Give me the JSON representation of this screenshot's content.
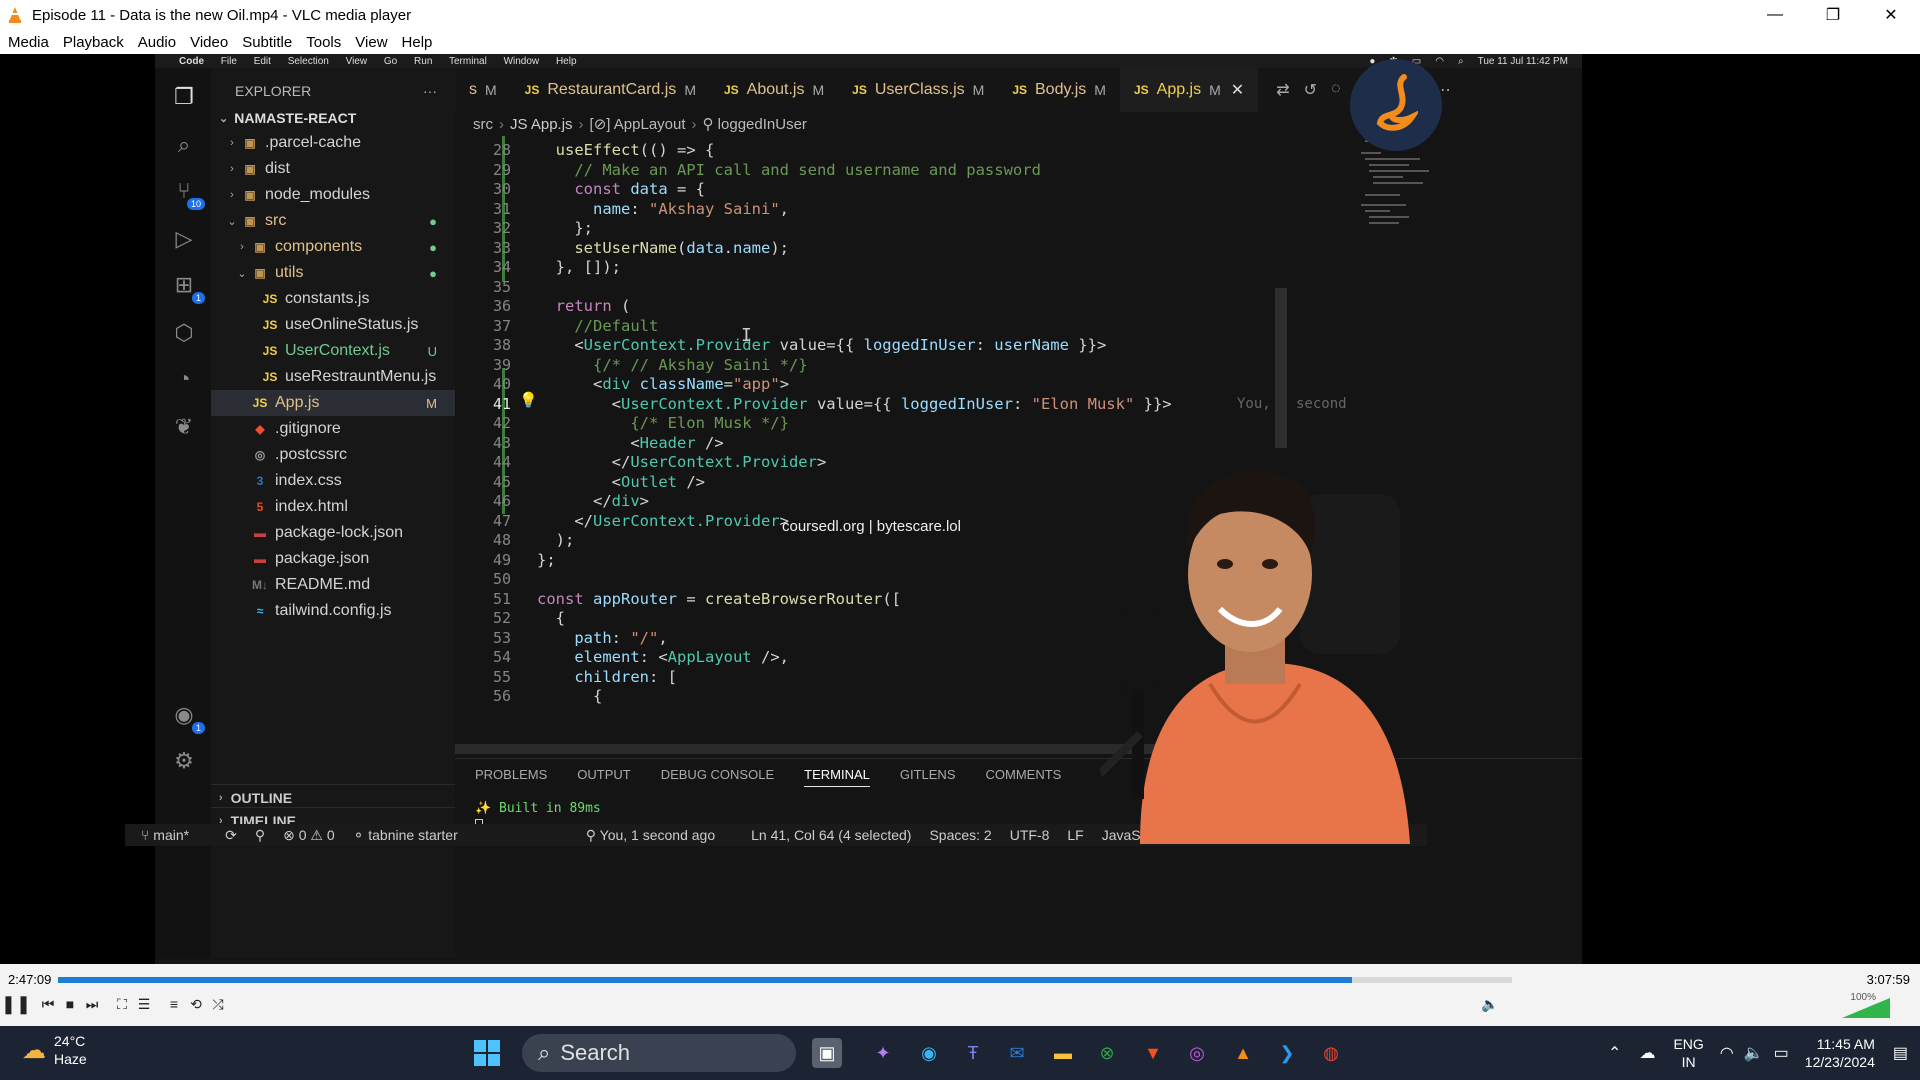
{
  "window": {
    "title": "Episode 11 - Data is the new Oil.mp4 - VLC media player",
    "controls": [
      "—",
      "❐",
      "✕"
    ]
  },
  "menu": [
    "Media",
    "Playback",
    "Audio",
    "Video",
    "Subtitle",
    "Tools",
    "View",
    "Help"
  ],
  "mac_menubar": {
    "items": [
      "Code",
      "File",
      "Edit",
      "Selection",
      "View",
      "Go",
      "Run",
      "Terminal",
      "Window",
      "Help"
    ],
    "clock": "Tue 11 Jul 11:42 PM"
  },
  "vscode": {
    "explorer_title": "EXPLORER",
    "explorer_more": "···",
    "project": "NAMASTE-REACT",
    "tree": [
      {
        "label": ".parcel-cache",
        "type": "folder",
        "indent": 1,
        "open": false,
        "mark": ""
      },
      {
        "label": "dist",
        "type": "folder",
        "indent": 1,
        "open": false,
        "mark": ""
      },
      {
        "label": "node_modules",
        "type": "folder",
        "indent": 1,
        "open": false,
        "mark": ""
      },
      {
        "label": "src",
        "type": "folder",
        "indent": 1,
        "open": true,
        "mark": "●"
      },
      {
        "label": "components",
        "type": "folder",
        "indent": 2,
        "open": false,
        "mark": "●"
      },
      {
        "label": "utils",
        "type": "folder",
        "indent": 2,
        "open": true,
        "mark": "●"
      },
      {
        "label": "constants.js",
        "type": "js",
        "indent": 3,
        "mark": ""
      },
      {
        "label": "useOnlineStatus.js",
        "type": "js",
        "indent": 3,
        "mark": ""
      },
      {
        "label": "UserContext.js",
        "type": "js",
        "indent": 3,
        "mark": "U"
      },
      {
        "label": "useRestrauntMenu.js",
        "type": "js",
        "indent": 3,
        "mark": ""
      },
      {
        "label": "App.js",
        "type": "js",
        "indent": 2,
        "mark": "M"
      },
      {
        "label": ".gitignore",
        "type": "git",
        "indent": 2,
        "mark": ""
      },
      {
        "label": ".postcssrc",
        "type": "cfg",
        "indent": 2,
        "mark": ""
      },
      {
        "label": "index.css",
        "type": "css",
        "indent": 2,
        "mark": ""
      },
      {
        "label": "index.html",
        "type": "html",
        "indent": 2,
        "mark": ""
      },
      {
        "label": "package-lock.json",
        "type": "json",
        "indent": 2,
        "mark": ""
      },
      {
        "label": "package.json",
        "type": "json",
        "indent": 2,
        "mark": ""
      },
      {
        "label": "README.md",
        "type": "md",
        "indent": 2,
        "mark": ""
      },
      {
        "label": "tailwind.config.js",
        "type": "tw",
        "indent": 2,
        "mark": ""
      }
    ],
    "outline": "OUTLINE",
    "timeline": "TIMELINE",
    "activity_badges": {
      "scm": "10",
      "extensions": "1",
      "accounts": "1"
    },
    "tabs": [
      {
        "label": "s",
        "modified": "M",
        "partial": true
      },
      {
        "label": "RestaurantCard.js",
        "modified": "M"
      },
      {
        "label": "About.js",
        "modified": "M"
      },
      {
        "label": "UserClass.js",
        "modified": "M"
      },
      {
        "label": "Body.js",
        "modified": "M"
      },
      {
        "label": "App.js",
        "modified": "M",
        "active": true
      }
    ],
    "tab_js": "JS",
    "close": "✕",
    "breadcrumb": [
      "src",
      "JS App.js",
      "[⊘] AppLayout",
      "⚲ loggedInUser"
    ],
    "code": [
      {
        "n": "28",
        "t": "  useEffect(() => {"
      },
      {
        "n": "29",
        "t": "    // Make an API call and send username and password"
      },
      {
        "n": "30",
        "t": "    const data = {"
      },
      {
        "n": "31",
        "t": "      name: \"Akshay Saini\","
      },
      {
        "n": "32",
        "t": "    };"
      },
      {
        "n": "33",
        "t": "    setUserName(data.name);"
      },
      {
        "n": "34",
        "t": "  }, []);"
      },
      {
        "n": "35",
        "t": ""
      },
      {
        "n": "36",
        "t": "  return ("
      },
      {
        "n": "37",
        "t": "    //Default"
      },
      {
        "n": "38",
        "t": "    <UserContext.Provider value={{ loggedInUser: userName }}>"
      },
      {
        "n": "39",
        "t": "      {/* // Akshay Saini */}"
      },
      {
        "n": "40",
        "t": "      <div className=\"app\">"
      },
      {
        "n": "41",
        "t": "        <UserContext.Provider value={{ loggedInUser: \"Elon Musk\" }}>",
        "current": true
      },
      {
        "n": "42",
        "t": "          {/* Elon Musk */}"
      },
      {
        "n": "43",
        "t": "          <Header />"
      },
      {
        "n": "44",
        "t": "        </UserContext.Provider>"
      },
      {
        "n": "45",
        "t": "        <Outlet />"
      },
      {
        "n": "46",
        "t": "      </div>"
      },
      {
        "n": "47",
        "t": "    </UserContext.Provider>"
      },
      {
        "n": "48",
        "t": "  );"
      },
      {
        "n": "49",
        "t": "};"
      },
      {
        "n": "50",
        "t": ""
      },
      {
        "n": "51",
        "t": "const appRouter = createBrowserRouter(["
      },
      {
        "n": "52",
        "t": "  {"
      },
      {
        "n": "53",
        "t": "    path: \"/\","
      },
      {
        "n": "54",
        "t": "    element: <AppLayout />,"
      },
      {
        "n": "55",
        "t": "    children: ["
      },
      {
        "n": "56",
        "t": "      {"
      }
    ],
    "blame": "You, 1 second ago • Uncomm",
    "watermark": "coursedl.org | bytescare.lol",
    "panel_tabs": [
      "PROBLEMS",
      "OUTPUT",
      "DEBUG CONSOLE",
      "TERMINAL",
      "GITLENS",
      "COMMENTS"
    ],
    "panel_active": "TERMINAL",
    "terminal_line": "✨ Built in 89ms",
    "status": {
      "branch": "main*",
      "problems": "⊗ 0 ⚠ 0",
      "tabnine": "⚬ tabnine starter",
      "blame": "You, 1 second ago",
      "position": "Ln 41, Col 64 (4 selected)",
      "spaces": "Spaces: 2",
      "encoding": "UTF-8",
      "eol": "LF",
      "language": "JavaScript"
    }
  },
  "player": {
    "elapsed": "2:47:09",
    "total": "3:07:59",
    "progress": 0.89,
    "volume_pct": "100%",
    "volume": 1.0
  },
  "taskbar": {
    "temp": "24°C",
    "weather": "Haze",
    "search": "Search",
    "lang1": "ENG",
    "lang2": "IN",
    "time": "11:45 AM",
    "date": "12/23/2024"
  },
  "colors": {
    "keyword": "#c586c0",
    "func": "#dcdcaa",
    "string": "#ce9178",
    "comment": "#6a9955",
    "var": "#9cdcfe",
    "tag": "#4ec9b0",
    "accent": "#1e7dd6"
  }
}
